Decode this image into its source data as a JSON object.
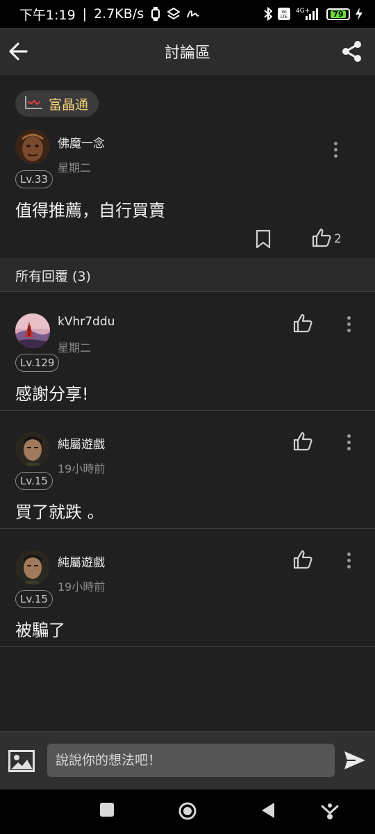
{
  "status_bar": {
    "time": "下午1:19",
    "network_speed": "2.7KB/s",
    "network_type": "4G+",
    "battery": "79"
  },
  "header": {
    "title": "討論區"
  },
  "post": {
    "stock_chip": "富晶通",
    "author": "佛魔一念",
    "time": "星期二",
    "level": "Lv.33",
    "content": "值得推薦，自行買賣",
    "like_count": "2"
  },
  "replies_header": "所有回覆 (3)",
  "replies": [
    {
      "author": "kVhr7ddu",
      "time": "星期二",
      "level": "Lv.129",
      "content": "感謝分享!"
    },
    {
      "author": "純屬遊戲",
      "time": "19小時前",
      "level": "Lv.15",
      "content": "買了就跌 。"
    },
    {
      "author": "純屬遊戲",
      "time": "19小時前",
      "level": "Lv.15",
      "content": "被騙了"
    }
  ],
  "input": {
    "placeholder": "說說你的想法吧！"
  },
  "colors": {
    "background": "#202020",
    "app_bar": "#2c2c2c",
    "chip_text": "#f5d37a",
    "battery_fill": "#6bdc3a"
  }
}
